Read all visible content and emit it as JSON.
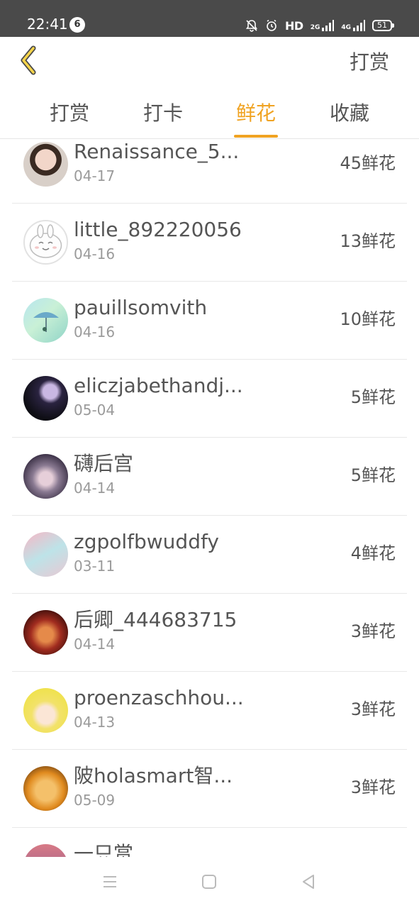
{
  "status_bar": {
    "time": "22:41",
    "notification_count": "6",
    "hd_label": "HD",
    "network_label_1": "2G",
    "network_label_2": "4G",
    "battery": "51"
  },
  "header": {
    "back_icon": "chevron-left-icon",
    "accent_color": "#f0a322",
    "action_label": "打赏"
  },
  "tabs": [
    {
      "label": "打赏",
      "active": false
    },
    {
      "label": "打卡",
      "active": false
    },
    {
      "label": "鲜花",
      "active": true
    },
    {
      "label": "收藏",
      "active": false
    }
  ],
  "list": {
    "items": [
      {
        "name": "Renaissance_5...",
        "date": "04-17",
        "count": "45鲜花"
      },
      {
        "name": "little_892220056",
        "date": "04-16",
        "count": "13鲜花"
      },
      {
        "name": "pauillsomvith",
        "date": "04-16",
        "count": "10鲜花"
      },
      {
        "name": "eliczjabethandj...",
        "date": "05-04",
        "count": "5鲜花"
      },
      {
        "name": "礴后宫",
        "date": "04-14",
        "count": "5鲜花"
      },
      {
        "name": "zgpolfbwuddfy",
        "date": "03-11",
        "count": "4鲜花"
      },
      {
        "name": "后卿_444683715",
        "date": "04-14",
        "count": "3鲜花"
      },
      {
        "name": "proenzaschhou...",
        "date": "04-13",
        "count": "3鲜花"
      },
      {
        "name": "陂holasmart智...",
        "date": "05-09",
        "count": "3鲜花"
      },
      {
        "name": "一只赏",
        "date": "",
        "count": ""
      }
    ]
  },
  "navbar": {
    "menu_icon": "menu-icon",
    "home_icon": "home-square-icon",
    "back_icon": "back-triangle-icon"
  }
}
